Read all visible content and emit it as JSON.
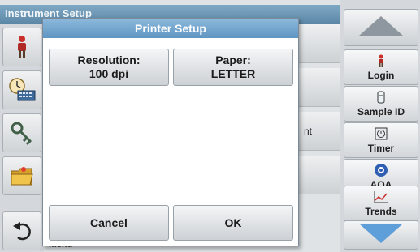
{
  "background": {
    "window_title": "Instrument Setup",
    "row_peek_text": "nt",
    "bottom_text": "menu"
  },
  "dialog": {
    "title": "Printer Setup",
    "resolution": {
      "label": "Resolution:",
      "value": "100 dpi"
    },
    "paper": {
      "label": "Paper:",
      "value": "LETTER"
    },
    "cancel_label": "Cancel",
    "ok_label": "OK"
  },
  "sidebar": {
    "login_label": "Login",
    "sample_id_label": "Sample ID",
    "timer_label": "Timer",
    "aqa_label": "AQA",
    "trends_label": "Trends"
  },
  "left_icons": [
    "person-icon",
    "clock-keyboard-icon",
    "key-icon",
    "folder-icon",
    "back-icon"
  ],
  "colors": {
    "title_bar": "#6fa5cf",
    "button_face": "#e6e8ea",
    "text": "#1b1b1b"
  }
}
